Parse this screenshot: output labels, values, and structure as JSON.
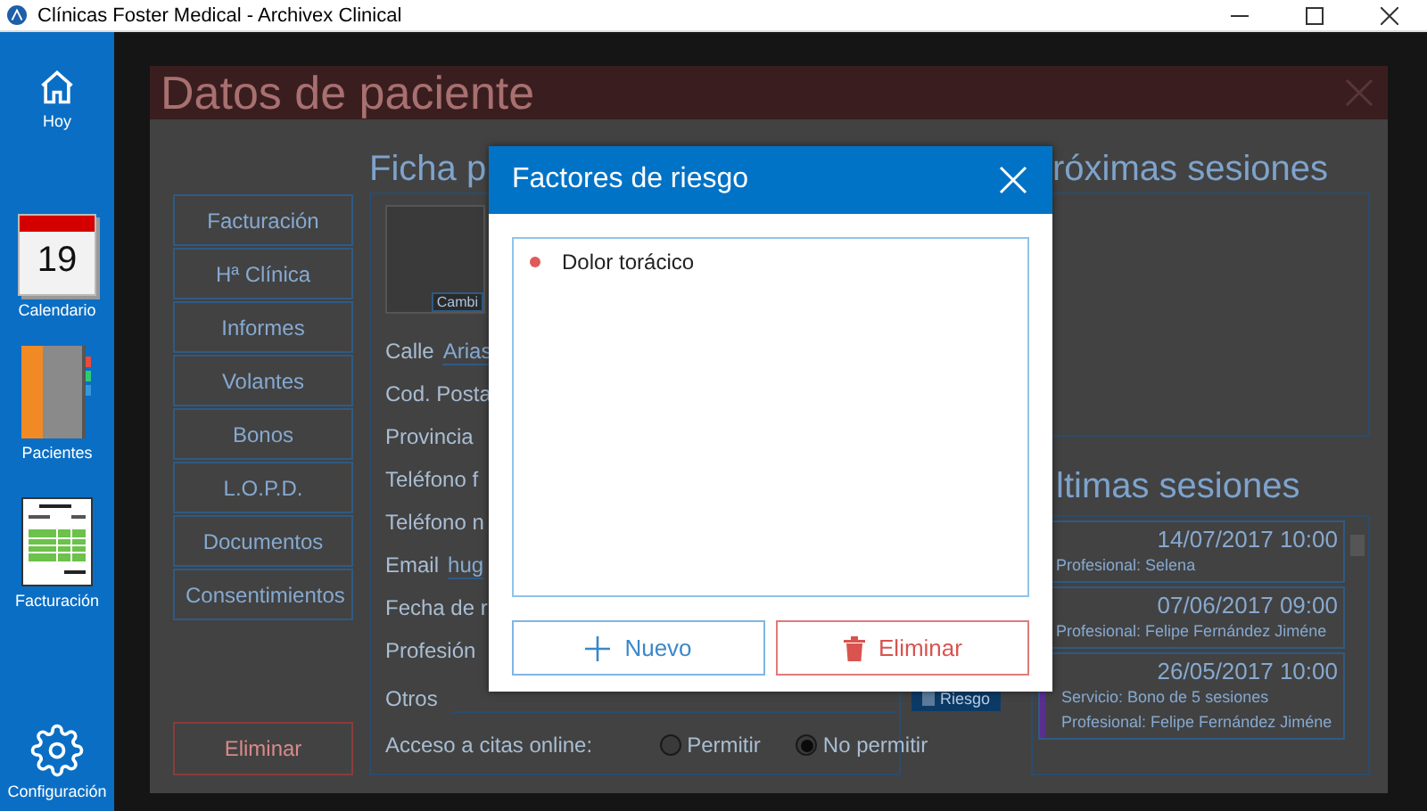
{
  "window": {
    "title": "Clínicas Foster Medical - Archivex Clinical"
  },
  "sidebar": {
    "items": [
      {
        "label": "Hoy",
        "kind": "home"
      },
      {
        "label": "Calendario",
        "kind": "calendar",
        "day": "19"
      },
      {
        "label": "Pacientes",
        "kind": "binder"
      },
      {
        "label": "Facturación",
        "kind": "invoice"
      },
      {
        "label": "Configuración",
        "kind": "settings"
      }
    ]
  },
  "panel": {
    "title": "Datos de paciente",
    "menu": [
      "Facturación",
      "Hª Clínica",
      "Informes",
      "Volantes",
      "Bonos",
      "L.O.P.D.",
      "Documentos",
      "Consentimientos"
    ],
    "delete_button": "Eliminar",
    "form": {
      "heading": "Ficha p",
      "photo_caption": "Cambi",
      "fields": [
        {
          "label": "Calle",
          "value": "Arias"
        },
        {
          "label": "Cod. Posta"
        },
        {
          "label": "Provincia"
        },
        {
          "label": "Teléfono f"
        },
        {
          "label": "Teléfono n"
        },
        {
          "label": "Email",
          "value": "hug"
        },
        {
          "label": "Fecha de r"
        },
        {
          "label": "Profesión"
        }
      ],
      "other_label": "Otros",
      "risk_button": "Riesgo",
      "online_access": {
        "label": "Acceso a citas online:",
        "options": [
          {
            "label": "Permitir",
            "selected": false
          },
          {
            "label": "No permitir",
            "selected": true
          }
        ]
      }
    },
    "upcoming": {
      "heading": "róximas sesiones"
    },
    "recent": {
      "heading": "ltimas sesiones",
      "sessions": [
        {
          "date": "14/07/2017 10:00",
          "lines": [
            {
              "key": "Profesional:",
              "value": "Selena"
            }
          ]
        },
        {
          "date": "07/06/2017 09:00",
          "lines": [
            {
              "key": "Profesional:",
              "value": "Felipe Fernández Jiméne"
            }
          ]
        },
        {
          "date": "26/05/2017 10:00",
          "color": "#5b2d91",
          "lines": [
            {
              "key": "Servicio:",
              "value": "Bono de 5 sesiones"
            },
            {
              "key": "Profesional:",
              "value": "Felipe Fernández Jiméne"
            }
          ]
        }
      ]
    }
  },
  "dialog": {
    "title": "Factores de riesgo",
    "items": [
      {
        "label": "Dolor torácico",
        "color": "#e05a5a"
      }
    ],
    "buttons": [
      {
        "label": "Nuevo",
        "kind": "add"
      },
      {
        "label": "Eliminar",
        "kind": "delete"
      }
    ]
  }
}
